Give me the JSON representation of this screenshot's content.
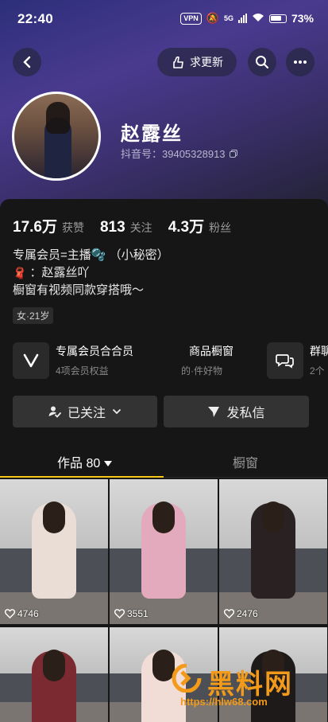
{
  "status_bar": {
    "time": "22:40",
    "vpn": "VPN",
    "network": "5G",
    "battery": "73%"
  },
  "header": {
    "update_label": "求更新"
  },
  "profile": {
    "name": "赵露丝",
    "douyin_id": "抖音号：39405328913"
  },
  "stats": [
    {
      "value": "17.6万",
      "label": "获赞"
    },
    {
      "value": "813",
      "label": "关注"
    },
    {
      "value": "4.3万",
      "label": "粉丝"
    }
  ],
  "bio": {
    "line1": "专属会员=主播🫧 （小秘密）",
    "line2": "：赵露丝吖",
    "line3": "橱窗有视频同款穿搭哦～",
    "tag": "女·21岁"
  },
  "cards": [
    {
      "title": "专属会员合合员",
      "sub": "4项会员权益"
    },
    {
      "title": "商品橱窗",
      "sub": "的·件好物"
    },
    {
      "title": "群聊",
      "sub": "2个"
    }
  ],
  "actions": {
    "follow": "已关注",
    "message": "发私信"
  },
  "tabs": {
    "works": "作品 80",
    "shop": "橱窗"
  },
  "posts": [
    {
      "likes": "4746",
      "outfit": "#e9ddd6"
    },
    {
      "likes": "3551",
      "outfit": "#e3a9bd"
    },
    {
      "likes": "2476",
      "outfit": "#2a2222"
    },
    {
      "likes": "",
      "outfit": "#7a2a30"
    },
    {
      "likes": "",
      "outfit": "#f2dcd6"
    },
    {
      "likes": "",
      "outfit": "#1e1a1a"
    }
  ],
  "watermark": {
    "text": "黑料网",
    "url": "https://hlw68.com"
  },
  "colors": {
    "accent": "#f5c518",
    "background": "#161616",
    "watermark": "#f29a1a"
  }
}
